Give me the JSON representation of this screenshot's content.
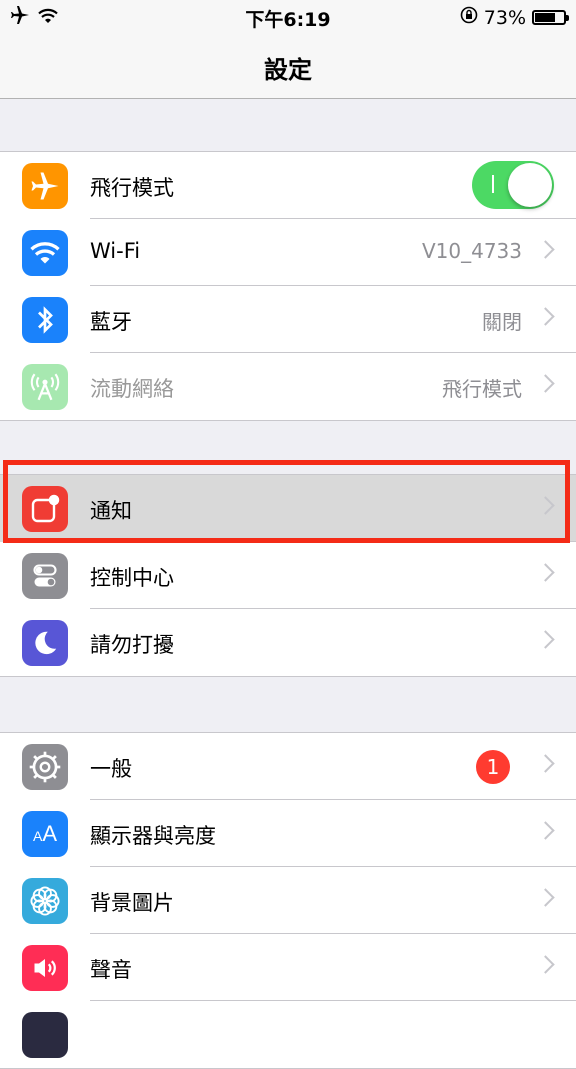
{
  "status_bar": {
    "time": "下午6:19",
    "battery_text": "73%",
    "battery_level": 0.73,
    "icons": [
      "airplane-icon",
      "wifi-icon",
      "orientation-lock-icon",
      "battery-icon"
    ]
  },
  "nav": {
    "title": "設定"
  },
  "group1": [
    {
      "label": "飛行模式",
      "icon": "airplane-icon",
      "color": "#ff9500",
      "toggle_on": true
    },
    {
      "label": "Wi-Fi",
      "value": "V10_4733",
      "icon": "wifi-icon",
      "color": "#1a82fb"
    },
    {
      "label": "藍牙",
      "value": "關閉",
      "icon": "bluetooth-icon",
      "color": "#1a82fb"
    },
    {
      "label": "流動網絡",
      "value": "飛行模式",
      "icon": "cellular-icon",
      "color": "#a7e8b0"
    }
  ],
  "group2": [
    {
      "label": "通知",
      "icon": "notifications-icon",
      "color": "#f03c34"
    },
    {
      "label": "控制中心",
      "icon": "control-center-icon",
      "color": "#8e8e93"
    },
    {
      "label": "請勿打擾",
      "icon": "moon-icon",
      "color": "#5856d6"
    }
  ],
  "group3": [
    {
      "label": "一般",
      "badge": "1",
      "icon": "gear-icon",
      "color": "#8e8e93"
    },
    {
      "label": "顯示器與亮度",
      "icon": "text-size-icon",
      "color": "#1a82fb"
    },
    {
      "label": "背景圖片",
      "icon": "wallpaper-icon",
      "color": "#35aadc"
    },
    {
      "label": "聲音",
      "icon": "speaker-icon",
      "color": "#ff2d55"
    }
  ],
  "highlight_color": "#f42b17"
}
